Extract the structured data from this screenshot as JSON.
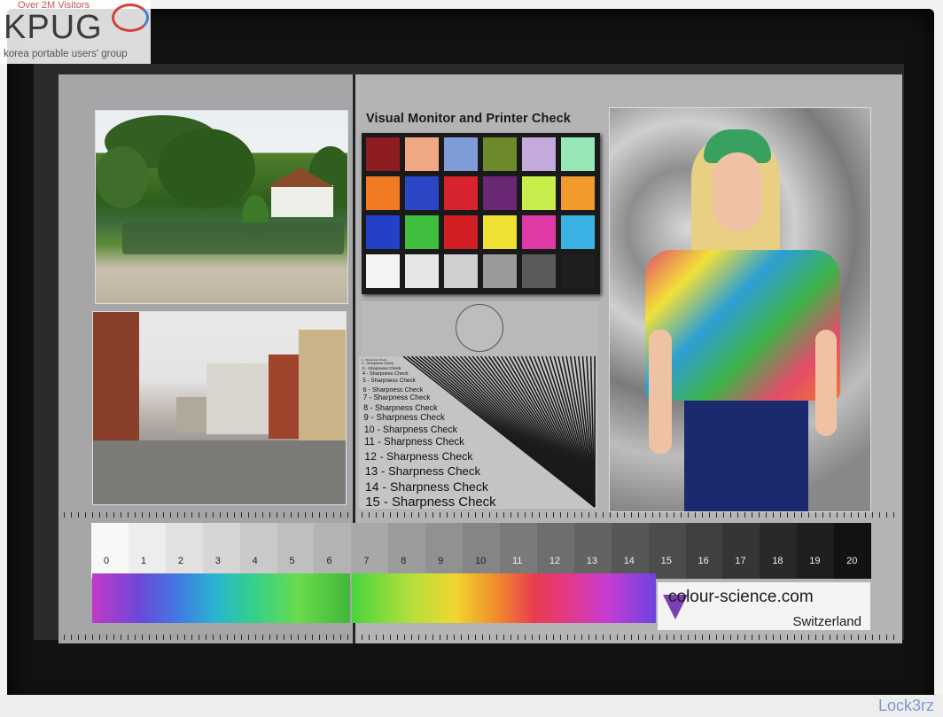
{
  "watermark": {
    "visitors": "Over 2M Visitors",
    "name": "KPUG",
    "subtitle": "korea portable users' group",
    "signature": "Lock3rz"
  },
  "chart_title": "Visual Monitor and Printer Check",
  "color_checker": [
    "#8e1c21",
    "#f0a884",
    "#7f9bd8",
    "#6d8a2a",
    "#c3a9dc",
    "#96e7b6",
    "#f07a22",
    "#2b46c6",
    "#d8222e",
    "#6a2874",
    "#c8ee4c",
    "#f29a2c",
    "#2240c8",
    "#3fbd3f",
    "#d31e24",
    "#f0e034",
    "#e03aa6",
    "#3ab2e4",
    "#f4f4f6",
    "#e6e6e8",
    "#d0d0d2",
    "#9a9a9c",
    "#5a5a5c",
    "#1e1e1e"
  ],
  "sharpness": {
    "labels": [
      "1 - Sharpness Check",
      "2 - Sharpness Check",
      "3 - Sharpness Check",
      "4 - Sharpness Check",
      "5 - Sharpness Check",
      "6 - Sharpness Check",
      "7 - Sharpness Check",
      "8 - Sharpness Check",
      "9 - Sharpness Check",
      "10 - Sharpness Check",
      "11 - Sharpness Check",
      "12 - Sharpness Check",
      "13 - Sharpness Check",
      "14 - Sharpness Check",
      "15 - Sharpness Check"
    ]
  },
  "grayscale": {
    "steps": [
      "0",
      "1",
      "2",
      "3",
      "4",
      "5",
      "6",
      "7",
      "8",
      "9",
      "10",
      "11",
      "12",
      "13",
      "14",
      "15",
      "16",
      "17",
      "18",
      "19",
      "20"
    ]
  },
  "brand": {
    "site": "colour-science.com",
    "country": "Switzerland"
  }
}
